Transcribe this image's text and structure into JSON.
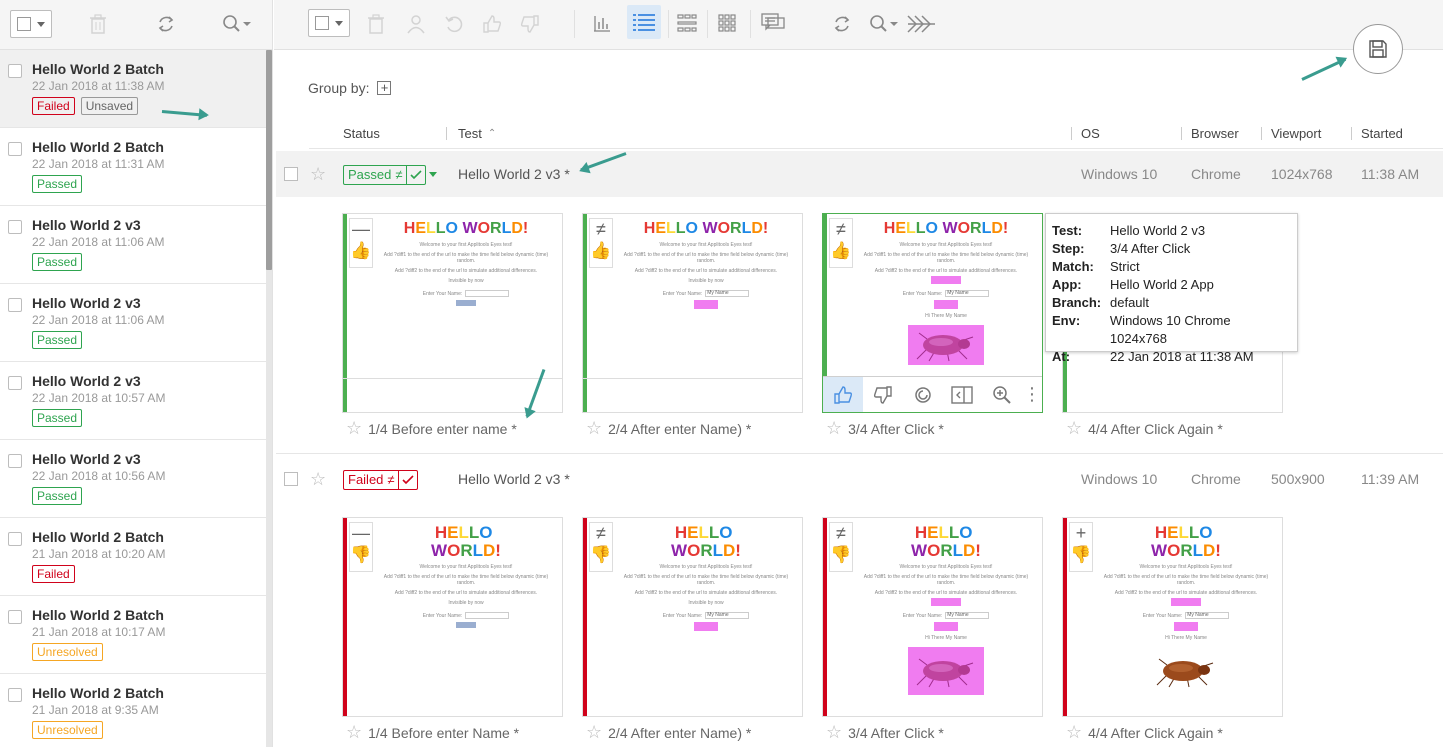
{
  "sidebar": {
    "batches": [
      {
        "name": "Hello World 2 Batch",
        "date": "22 Jan 2018 at 11:38 AM",
        "badges": [
          {
            "label": "Failed",
            "kind": "failed"
          },
          {
            "label": "Unsaved",
            "kind": "unsaved"
          }
        ],
        "selected": true
      },
      {
        "name": "Hello World 2 Batch",
        "date": "22 Jan 2018 at 11:31 AM",
        "badges": [
          {
            "label": "Passed",
            "kind": "passed"
          }
        ]
      },
      {
        "name": "Hello World 2 v3",
        "date": "22 Jan 2018 at 11:06 AM",
        "badges": [
          {
            "label": "Passed",
            "kind": "passed"
          }
        ]
      },
      {
        "name": "Hello World 2 v3",
        "date": "22 Jan 2018 at 11:06 AM",
        "badges": [
          {
            "label": "Passed",
            "kind": "passed"
          }
        ]
      },
      {
        "name": "Hello World 2 v3",
        "date": "22 Jan 2018 at 10:57 AM",
        "badges": [
          {
            "label": "Passed",
            "kind": "passed"
          }
        ]
      },
      {
        "name": "Hello World 2 v3",
        "date": "22 Jan 2018 at 10:56 AM",
        "badges": [
          {
            "label": "Passed",
            "kind": "passed"
          }
        ]
      },
      {
        "name": "Hello World 2 Batch",
        "date": "21 Jan 2018 at 10:20 AM",
        "badges": [
          {
            "label": "Failed",
            "kind": "failed"
          }
        ]
      },
      {
        "name": "Hello World 2 Batch",
        "date": "21 Jan 2018 at 10:17 AM",
        "badges": [
          {
            "label": "Unresolved",
            "kind": "unres"
          }
        ]
      },
      {
        "name": "Hello World 2 Batch",
        "date": "21 Jan 2018 at 9:35 AM",
        "badges": [
          {
            "label": "Unresolved",
            "kind": "unres"
          }
        ]
      }
    ]
  },
  "main": {
    "group_by_label": "Group by:",
    "columns": {
      "status": "Status",
      "test": "Test",
      "os": "OS",
      "browser": "Browser",
      "viewport": "Viewport",
      "started": "Started"
    },
    "tests": [
      {
        "status": "Passed",
        "status_symbol": "≠",
        "name": "Hello World 2 v3 *",
        "os": "Windows 10",
        "browser": "Chrome",
        "viewport": "1024x768",
        "started": "11:38 AM",
        "steps": [
          {
            "label": "1/4 Before enter name *",
            "mark": "—"
          },
          {
            "label": "2/4 After enter Name) *",
            "mark": "≠"
          },
          {
            "label": "3/4 After Click *",
            "mark": "≠"
          },
          {
            "label": "4/4 After Click Again *",
            "mark": ""
          }
        ]
      },
      {
        "status": "Failed",
        "status_symbol": "≠",
        "name": "Hello World 2 v3 *",
        "os": "Windows 10",
        "browser": "Chrome",
        "viewport": "500x900",
        "started": "11:39 AM",
        "steps": [
          {
            "label": "1/4 Before enter Name *",
            "mark": "—"
          },
          {
            "label": "2/4 After enter Name) *",
            "mark": "≠"
          },
          {
            "label": "3/4 After Click *",
            "mark": "≠"
          },
          {
            "label": "4/4 After Click Again *",
            "mark": "+"
          }
        ]
      }
    ],
    "screenshot": {
      "hello": [
        "H",
        "E",
        "L",
        "L",
        "O",
        " ",
        "W",
        "O",
        "R",
        "L",
        "D",
        "!"
      ],
      "hello_colors": [
        "#e53935",
        "#fb8c00",
        "#fdd835",
        "#43a047",
        "#1e88e5",
        "#fff",
        "#8e24aa",
        "#e53935",
        "#43a047",
        "#1e88e5",
        "#fb8c00",
        "#e53935"
      ],
      "intro": "Welcome to your first Applitools Eyes test!",
      "line1": "Add ?diff1 to the end of the url to make the time field below dynamic (time) random.",
      "line2": "Add ?diff2 to the end of the url to simulate additional differences.",
      "date_line": "Invisible by now",
      "form_label": "Enter Your Name:",
      "name_value": "My Name",
      "button_label": "Click me!",
      "greeting": "Hi There My Name"
    },
    "tooltip": {
      "rows": [
        {
          "k": "Test:",
          "v": "Hello World 2 v3"
        },
        {
          "k": "Step:",
          "v": "3/4 After Click"
        },
        {
          "k": "Match:",
          "v": "Strict"
        },
        {
          "k": "App:",
          "v": "Hello World 2 App"
        },
        {
          "k": "Branch:",
          "v": "default"
        },
        {
          "k": "Env:",
          "v": "Windows 10 Chrome 1024x768"
        },
        {
          "k": "At:",
          "v": "22 Jan 2018 at 11:38 AM"
        }
      ]
    }
  },
  "colors": {
    "passed": "#2ea44f",
    "failed": "#d0021b",
    "unresolved": "#f5a623",
    "arrow": "#3a9c8f",
    "accent": "#4a90e2"
  }
}
